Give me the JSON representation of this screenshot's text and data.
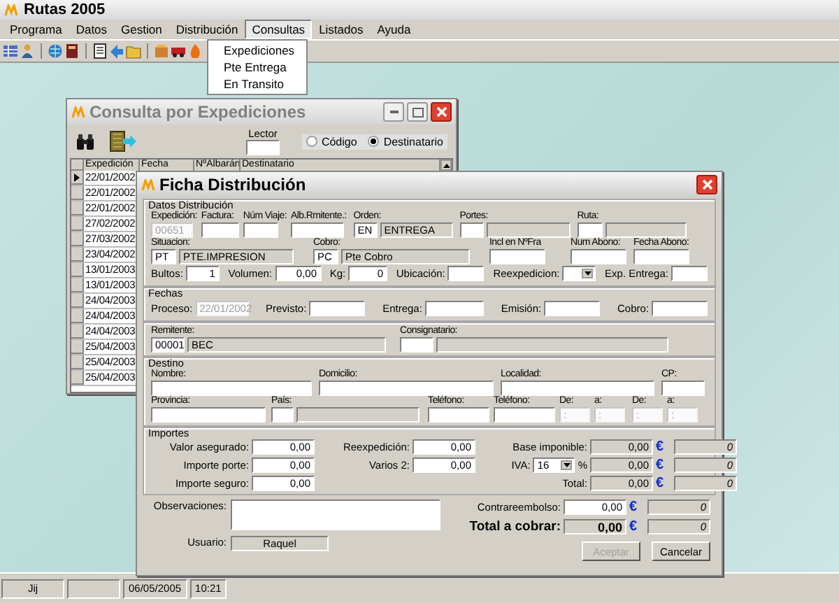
{
  "window": {
    "title": "Rutas 2005"
  },
  "menu": [
    {
      "label": "Programa",
      "selected": false
    },
    {
      "label": "Datos",
      "selected": false
    },
    {
      "label": "Gestion",
      "selected": false
    },
    {
      "label": "Distribución",
      "selected": false
    },
    {
      "label": "Consultas",
      "selected": true
    },
    {
      "label": "Listados",
      "selected": false
    },
    {
      "label": "Ayuda",
      "selected": false
    }
  ],
  "dropdown": [
    {
      "label": "Expediciones"
    },
    {
      "label": "Pte Entrega"
    },
    {
      "label": "En Transito"
    }
  ],
  "consulta": {
    "title": "Consulta por Expediciones",
    "lector": {
      "label": "Lector"
    },
    "radios": [
      {
        "label": "Código",
        "selected": false
      },
      {
        "label": "Destinatario",
        "selected": true
      }
    ],
    "columns": [
      "Expedición",
      "Fecha",
      "NºAlbarán",
      "Destinatario"
    ],
    "rows": [
      {
        "value": "22/01/2002",
        "selected": true
      },
      {
        "value": "22/01/2002",
        "selected": false
      },
      {
        "value": "22/01/2002",
        "selected": false
      },
      {
        "value": "27/02/2002",
        "selected": false
      },
      {
        "value": "27/03/2002",
        "selected": false
      },
      {
        "value": "23/04/2002",
        "selected": false
      },
      {
        "value": "13/01/2003",
        "selected": false
      },
      {
        "value": "13/01/2003",
        "selected": false
      },
      {
        "value": "24/04/2003",
        "selected": false
      },
      {
        "value": "24/04/2003",
        "selected": false
      },
      {
        "value": "24/04/2003",
        "selected": false
      },
      {
        "value": "25/04/2003",
        "selected": false
      },
      {
        "value": "25/04/2003",
        "selected": false
      },
      {
        "value": "25/04/2003",
        "selected": false
      }
    ]
  },
  "ficha": {
    "title": "Ficha Distribución",
    "sections": [
      {
        "legend": "Datos Distribución",
        "rows": [
          {
            "kind": "stacked",
            "fields": [
              {
                "kind": "text",
                "label": "Expedición:",
                "value": "00651",
                "disabled": true
              },
              {
                "kind": "text",
                "label": "Factura:",
                "disabled": false
              },
              {
                "kind": "text",
                "label": "Núm Viaje:",
                "disabled": false
              },
              {
                "kind": "text",
                "label": "Alb.Rmitente.:",
                "disabled": false
              },
              {
                "kind": "coded",
                "label": "Orden:",
                "code": "EN",
                "value": "ENTREGA",
                "disabled": false
              },
              {
                "kind": "coded",
                "label": "Portes:",
                "disabled": false
              },
              {
                "kind": "coded",
                "label": "Ruta:",
                "disabled": false
              }
            ]
          },
          {
            "kind": "stacked",
            "fields": [
              {
                "kind": "coded",
                "label": "Situacion:",
                "code": "PT",
                "value": "PTE.IMPRESION"
              },
              {
                "kind": "coded",
                "label": "Cobro:",
                "code": "PC",
                "value": "Pte Cobro"
              },
              {
                "kind": "text",
                "label": "Incl en NºFra"
              },
              {
                "kind": "text",
                "label": "Num Abono:"
              },
              {
                "kind": "text",
                "label": "Fecha Abono:"
              }
            ]
          },
          {
            "kind": "inline",
            "fields": [
              {
                "kind": "number",
                "label": "Bultos:",
                "value": "1"
              },
              {
                "kind": "number",
                "label": "Volumen:",
                "value": "0,00"
              },
              {
                "kind": "number",
                "label": "Kg:",
                "value": "0"
              },
              {
                "kind": "text",
                "label": "Ubicación:"
              },
              {
                "kind": "select",
                "label": "Reexpedicion:"
              },
              {
                "kind": "text",
                "label": "Exp. Entrega:"
              }
            ]
          }
        ]
      },
      {
        "legend": "Fechas",
        "rows": [
          {
            "kind": "inline",
            "fields": [
              {
                "kind": "text",
                "label": "Proceso:",
                "value": "22/01/2002",
                "disabled": true
              },
              {
                "kind": "text",
                "label": "Previsto:",
                "disabled": false
              },
              {
                "kind": "text",
                "label": "Entrega:",
                "disabled": false
              },
              {
                "kind": "text",
                "label": "Emisión:",
                "disabled": false
              },
              {
                "kind": "text",
                "label": "Cobro:",
                "disabled": false
              }
            ]
          }
        ]
      },
      {
        "rows": [
          {
            "kind": "stacked",
            "fields": [
              {
                "kind": "coded",
                "label": "Remitente:",
                "code": "00001",
                "value": "BEC"
              },
              {
                "kind": "coded",
                "label": "Consignatario:"
              }
            ]
          }
        ]
      },
      {
        "legend": "Destino",
        "rows": [
          {
            "kind": "stacked",
            "fields": [
              {
                "kind": "text",
                "label": "Nombre:"
              },
              {
                "kind": "text",
                "label": "Domicilio:"
              },
              {
                "kind": "text",
                "label": "Localidad:"
              },
              {
                "kind": "text",
                "label": "CP:"
              }
            ]
          },
          {
            "kind": "stacked",
            "fields": [
              {
                "kind": "text",
                "label": "Provincia:",
                "disabled": false
              },
              {
                "kind": "coded",
                "label": "País:",
                "disabled": false
              },
              {
                "kind": "text",
                "label": "Teléfono:",
                "disabled": false
              },
              {
                "kind": "text",
                "label": "Teléfono:",
                "disabled": false
              },
              {
                "kind": "text",
                "label": "De:",
                "value": ":",
                "disabled": true
              },
              {
                "kind": "text",
                "label": "a:",
                "value": ":",
                "disabled": true
              },
              {
                "kind": "text",
                "label": "De:",
                "value": ":",
                "disabled": true
              },
              {
                "kind": "text",
                "label": "a:",
                "value": ":",
                "disabled": true
              }
            ]
          }
        ]
      }
    ],
    "importes": {
      "legend": "Importes",
      "left": [
        {
          "label": "Valor asegurado:",
          "value": "0,00"
        },
        {
          "label": "Importe porte:",
          "value": "0,00"
        },
        {
          "label": "Importe seguro:",
          "value": "0,00"
        }
      ],
      "middle": [
        {
          "label": "Reexpedición:",
          "value": "0,00"
        },
        {
          "label": "Varios 2:",
          "value": "0,00"
        }
      ],
      "right": [
        {
          "kind": "amount",
          "label": "Base imponible:",
          "value": "0,00",
          "currency": "€",
          "alt_value": "0"
        },
        {
          "kind": "iva",
          "label": "IVA:",
          "select": "16",
          "unit": "%",
          "value": "0,00",
          "currency": "€",
          "alt_value": "0"
        },
        {
          "kind": "amount",
          "label": "Total:",
          "value": "0,00",
          "currency": "€",
          "alt_value": "0"
        }
      ]
    },
    "observaciones": {
      "label": "Observaciones:"
    },
    "usuario": {
      "label": "Usuario:",
      "value": "Raquel"
    },
    "totals": [
      {
        "kind": "input",
        "label": "Contrareembolso:",
        "value": "0,00",
        "currency": "€",
        "alt_value": "0"
      },
      {
        "kind": "total",
        "label": "Total a cobrar:",
        "value": "0,00",
        "currency": "€",
        "alt_value": "0"
      }
    ],
    "buttons": [
      {
        "label": "Aceptar",
        "disabled": true
      },
      {
        "label": "Cancelar",
        "disabled": false
      }
    ]
  },
  "status_bar": {
    "user": "Jij",
    "date": "06/05/2005",
    "time": "10:21"
  }
}
